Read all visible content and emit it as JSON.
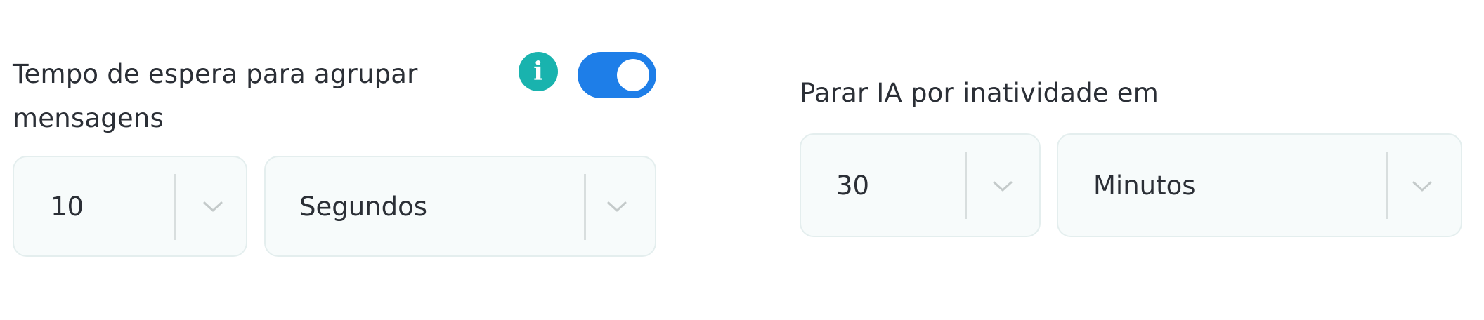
{
  "wait_group": {
    "label": "Tempo de espera para agrupar mensagens",
    "info_icon": "info-icon",
    "info_glyph": "i",
    "toggle_on": true,
    "accent_color": "#1e7ee8",
    "info_color": "#19b3ae",
    "amount": {
      "value": "10",
      "icon": "chevron-down-icon"
    },
    "unit": {
      "value": "Segundos",
      "icon": "chevron-down-icon"
    }
  },
  "inactivity_stop": {
    "label": "Parar IA por inatividade em",
    "amount": {
      "value": "30",
      "icon": "chevron-down-icon"
    },
    "unit": {
      "value": "Minutos",
      "icon": "chevron-down-icon"
    }
  }
}
